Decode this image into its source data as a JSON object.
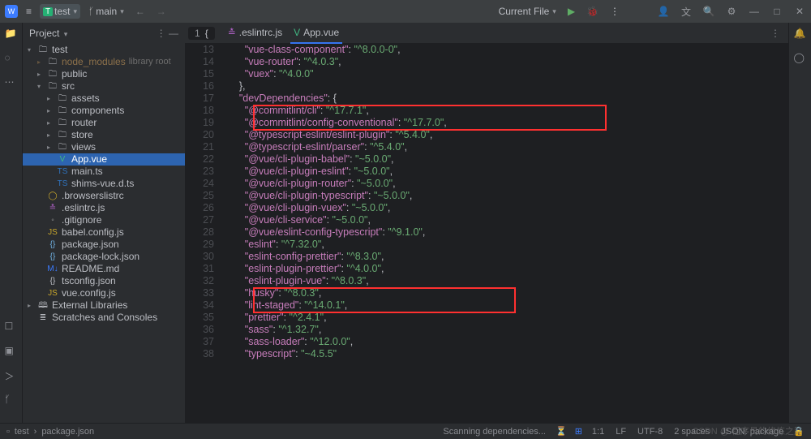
{
  "titlebar": {
    "project": "test",
    "branch": "main",
    "run_config": "Current File"
  },
  "sidebar": {
    "title": "Project",
    "tree": [
      {
        "depth": 0,
        "arrow": "▾",
        "icon": "folder",
        "label": "test",
        "hint": "",
        "cls": ""
      },
      {
        "depth": 1,
        "arrow": "▸",
        "icon": "folder",
        "label": "node_modules",
        "hint": "library root",
        "cls": "nm"
      },
      {
        "depth": 1,
        "arrow": "▸",
        "icon": "folder",
        "label": "public",
        "hint": "",
        "cls": ""
      },
      {
        "depth": 1,
        "arrow": "▾",
        "icon": "folder",
        "label": "src",
        "hint": "",
        "cls": ""
      },
      {
        "depth": 2,
        "arrow": "▸",
        "icon": "folder",
        "label": "assets",
        "hint": "",
        "cls": ""
      },
      {
        "depth": 2,
        "arrow": "▸",
        "icon": "folder",
        "label": "components",
        "hint": "",
        "cls": ""
      },
      {
        "depth": 2,
        "arrow": "▸",
        "icon": "folder",
        "label": "router",
        "hint": "",
        "cls": ""
      },
      {
        "depth": 2,
        "arrow": "▸",
        "icon": "folder",
        "label": "store",
        "hint": "",
        "cls": ""
      },
      {
        "depth": 2,
        "arrow": "▸",
        "icon": "folder",
        "label": "views",
        "hint": "",
        "cls": ""
      },
      {
        "depth": 2,
        "arrow": "",
        "icon": "vue",
        "label": "App.vue",
        "hint": "",
        "cls": "sel"
      },
      {
        "depth": 2,
        "arrow": "",
        "icon": "ts",
        "label": "main.ts",
        "hint": "",
        "cls": ""
      },
      {
        "depth": 2,
        "arrow": "",
        "icon": "ts",
        "label": "shims-vue.d.ts",
        "hint": "",
        "cls": ""
      },
      {
        "depth": 1,
        "arrow": "",
        "icon": "brow",
        "label": ".browserslistrc",
        "hint": "",
        "cls": ""
      },
      {
        "depth": 1,
        "arrow": "",
        "icon": "esl",
        "label": ".eslintrc.js",
        "hint": "",
        "cls": ""
      },
      {
        "depth": 1,
        "arrow": "",
        "icon": "git",
        "label": ".gitignore",
        "hint": "",
        "cls": ""
      },
      {
        "depth": 1,
        "arrow": "",
        "icon": "js",
        "label": "babel.config.js",
        "hint": "",
        "cls": ""
      },
      {
        "depth": 1,
        "arrow": "",
        "icon": "pkg",
        "label": "package.json",
        "hint": "",
        "cls": ""
      },
      {
        "depth": 1,
        "arrow": "",
        "icon": "pkg",
        "label": "package-lock.json",
        "hint": "",
        "cls": ""
      },
      {
        "depth": 1,
        "arrow": "",
        "icon": "md",
        "label": "README.md",
        "hint": "",
        "cls": ""
      },
      {
        "depth": 1,
        "arrow": "",
        "icon": "json",
        "label": "tsconfig.json",
        "hint": "",
        "cls": ""
      },
      {
        "depth": 1,
        "arrow": "",
        "icon": "js",
        "label": "vue.config.js",
        "hint": "",
        "cls": ""
      },
      {
        "depth": 0,
        "arrow": "▸",
        "icon": "ext",
        "label": "External Libraries",
        "hint": "",
        "cls": ""
      },
      {
        "depth": 0,
        "arrow": "",
        "icon": "scr",
        "label": "Scratches and Consoles",
        "hint": "",
        "cls": ""
      }
    ]
  },
  "tabs": {
    "crumb_num": "1",
    "crumb_br": "{",
    "items": [
      {
        "icon": "esl",
        "label": ".eslintrc.js",
        "act": false
      },
      {
        "icon": "vue",
        "label": "App.vue",
        "act": true
      }
    ]
  },
  "code": {
    "start": 13,
    "lines": [
      {
        "ind": 2,
        "k": "\"vue-class-component\"",
        "v": "\"^8.0.0-0\"",
        "comma": true
      },
      {
        "ind": 2,
        "k": "\"vue-router\"",
        "v": "\"^4.0.3\"",
        "comma": true
      },
      {
        "ind": 2,
        "k": "\"vuex\"",
        "v": "\"^4.0.0\"",
        "comma": false
      },
      {
        "ind": 1,
        "raw": "},",
        "k": "",
        "v": ""
      },
      {
        "ind": 1,
        "k": "\"devDependencies\"",
        "v": "{",
        "open": true,
        "comma": false
      },
      {
        "ind": 2,
        "k": "\"@commitlint/cli\"",
        "v": "\"^17.7.1\"",
        "comma": true
      },
      {
        "ind": 2,
        "k": "\"@commitlint/config-conventional\"",
        "v": "\"^17.7.0\"",
        "comma": true
      },
      {
        "ind": 2,
        "k": "\"@typescript-eslint/eslint-plugin\"",
        "v": "\"^5.4.0\"",
        "comma": true
      },
      {
        "ind": 2,
        "k": "\"@typescript-eslint/parser\"",
        "v": "\"^5.4.0\"",
        "comma": true
      },
      {
        "ind": 2,
        "k": "\"@vue/cli-plugin-babel\"",
        "v": "\"~5.0.0\"",
        "comma": true
      },
      {
        "ind": 2,
        "k": "\"@vue/cli-plugin-eslint\"",
        "v": "\"~5.0.0\"",
        "comma": true
      },
      {
        "ind": 2,
        "k": "\"@vue/cli-plugin-router\"",
        "v": "\"~5.0.0\"",
        "comma": true
      },
      {
        "ind": 2,
        "k": "\"@vue/cli-plugin-typescript\"",
        "v": "\"~5.0.0\"",
        "comma": true
      },
      {
        "ind": 2,
        "k": "\"@vue/cli-plugin-vuex\"",
        "v": "\"~5.0.0\"",
        "comma": true
      },
      {
        "ind": 2,
        "k": "\"@vue/cli-service\"",
        "v": "\"~5.0.0\"",
        "comma": true
      },
      {
        "ind": 2,
        "k": "\"@vue/eslint-config-typescript\"",
        "v": "\"^9.1.0\"",
        "comma": true
      },
      {
        "ind": 2,
        "k": "\"eslint\"",
        "v": "\"^7.32.0\"",
        "comma": true
      },
      {
        "ind": 2,
        "k": "\"eslint-config-prettier\"",
        "v": "\"^8.3.0\"",
        "comma": true
      },
      {
        "ind": 2,
        "k": "\"eslint-plugin-prettier\"",
        "v": "\"^4.0.0\"",
        "comma": true
      },
      {
        "ind": 2,
        "k": "\"eslint-plugin-vue\"",
        "v": "\"^8.0.3\"",
        "comma": true
      },
      {
        "ind": 2,
        "k": "\"husky\"",
        "v": "\"^8.0.3\"",
        "comma": true
      },
      {
        "ind": 2,
        "k": "\"lint-staged\"",
        "v": "\"^14.0.1\"",
        "comma": true
      },
      {
        "ind": 2,
        "k": "\"prettier\"",
        "v": "\"^2.4.1\"",
        "comma": true
      },
      {
        "ind": 2,
        "k": "\"sass\"",
        "v": "\"^1.32.7\"",
        "comma": true
      },
      {
        "ind": 2,
        "k": "\"sass-loader\"",
        "v": "\"^12.0.0\"",
        "comma": true
      },
      {
        "ind": 2,
        "k": "\"typescript\"",
        "v": "\"~4.5.5\"",
        "comma": false
      }
    ]
  },
  "status": {
    "breadcrumb": [
      "test",
      "package.json"
    ],
    "scanning": "Scanning dependencies...",
    "pos": "1:1",
    "eol": "LF",
    "enc": "UTF-8",
    "indent": "2 spaces",
    "lang": "JSON: package"
  },
  "watermark": "CSDN @ 程序员的修炼之路"
}
